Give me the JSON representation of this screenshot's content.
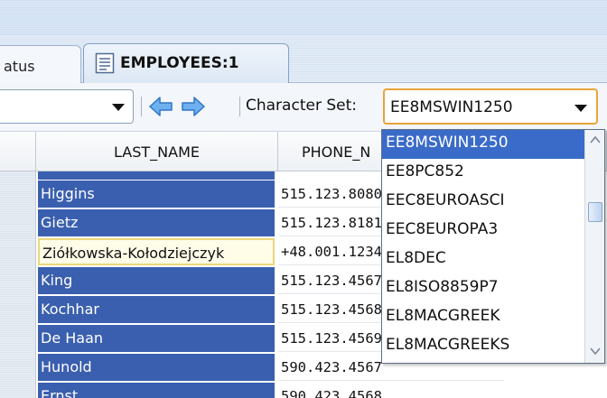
{
  "tabs": [
    {
      "label": "atus"
    },
    {
      "label": "EMPLOYEES:1"
    }
  ],
  "toolbar": {
    "charset_label": "Character Set:",
    "charset_value": "EE8MSWIN1250"
  },
  "grid": {
    "columns": [
      {
        "label": "LAST_NAME"
      },
      {
        "label": "PHONE_N"
      }
    ],
    "rows": [
      {
        "last_name": "Higgins",
        "phone": "515.123.8080"
      },
      {
        "last_name": "Gietz",
        "phone": "515.123.8181"
      },
      {
        "last_name": "Ziółkowska-Kołodziejczyk",
        "phone": "+48.001.1234"
      },
      {
        "last_name": "King",
        "phone": "515.123.4567"
      },
      {
        "last_name": "Kochhar",
        "phone": "515.123.4568"
      },
      {
        "last_name": "De Haan",
        "phone": "515.123.4569"
      },
      {
        "last_name": "Hunold",
        "phone": "590.423.4567"
      },
      {
        "last_name": "Ernst",
        "phone": "590.423.4568"
      }
    ]
  },
  "charset_options": [
    "EE8MSWIN1250",
    "EE8PC852",
    "EEC8EUROASCI",
    "EEC8EUROPA3",
    "EL8DEC",
    "EL8ISO8859P7",
    "EL8MACGREEK",
    "EL8MACGREEKS"
  ],
  "colors": {
    "selection": "#3a5fae",
    "dropdown_selected": "#3a6bc8",
    "focus_border": "#e8a53a",
    "nav_arrow": "#3f8fe0"
  }
}
